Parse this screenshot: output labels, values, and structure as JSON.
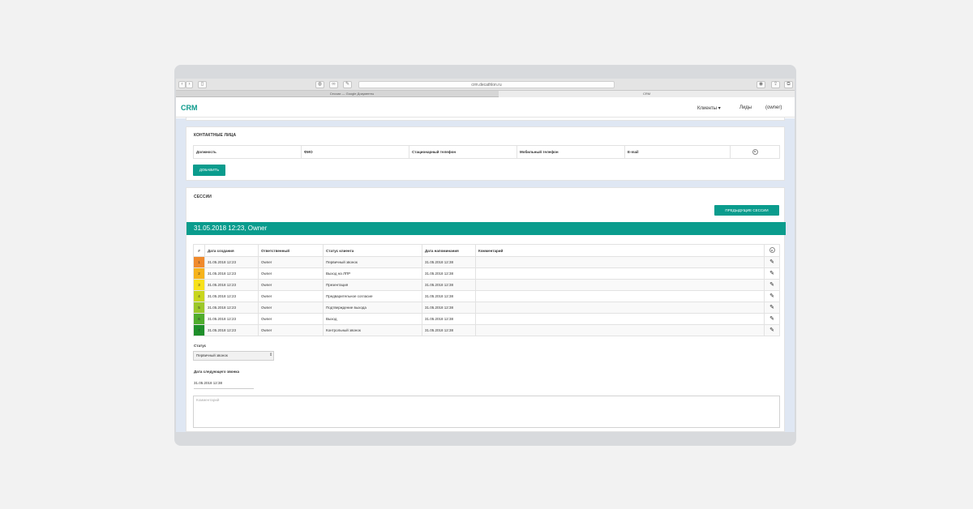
{
  "browser": {
    "url": "crm.decathlon.ru",
    "tabs": [
      "Сессии — Google Документы",
      "CRM"
    ]
  },
  "header": {
    "logo": "CRM",
    "nav": [
      "Клиенты ▾",
      "Лиды",
      "(owner)"
    ]
  },
  "contacts": {
    "title": "КОНТАКТНЫЕ ЛИЦА",
    "columns": [
      "Должность",
      "ФИО",
      "Стационарный телефон",
      "Мобильный телефон",
      "E-mail"
    ],
    "add_label": "ДОБАВИТЬ"
  },
  "sessions": {
    "title": "СЕССИИ",
    "prev_label": "ПРЕДЫДУЩИЕ СЕССИИ",
    "current": "31.05.2018 12:23, Owner",
    "columns": [
      "#",
      "Дата создания",
      "Ответственный",
      "Статус клиента",
      "Дата напоминания",
      "Комментарий"
    ],
    "rows": [
      {
        "n": "1",
        "created": "31.05.2018 12:23",
        "owner": "Owner",
        "status": "Первичный звонок",
        "remind": "31.05.2018 12:38",
        "comment": "",
        "color": "#f08a2c"
      },
      {
        "n": "2",
        "created": "31.05.2018 12:23",
        "owner": "Owner",
        "status": "Выход на ЛПР",
        "remind": "31.05.2018 12:38",
        "comment": "",
        "color": "#f6b31b"
      },
      {
        "n": "3",
        "created": "31.05.2018 12:23",
        "owner": "Owner",
        "status": "Презентация",
        "remind": "31.05.2018 12:38",
        "comment": "",
        "color": "#f7e11b"
      },
      {
        "n": "4",
        "created": "31.05.2018 12:23",
        "owner": "Owner",
        "status": "Предварительное согласие",
        "remind": "31.05.2018 12:38",
        "comment": "",
        "color": "#c8d61c"
      },
      {
        "n": "5",
        "created": "31.05.2018 12:23",
        "owner": "Owner",
        "status": "Подтверждение выхода",
        "remind": "31.05.2018 12:38",
        "comment": "",
        "color": "#9cc82a"
      },
      {
        "n": "6",
        "created": "31.05.2018 12:23",
        "owner": "Owner",
        "status": "Выход",
        "remind": "31.05.2018 12:38",
        "comment": "",
        "color": "#4fad2d"
      },
      {
        "n": "7",
        "created": "31.05.2018 12:23",
        "owner": "Owner",
        "status": "Контрольный звонок",
        "remind": "31.05.2018 12:38",
        "comment": "",
        "color": "#1e8f2a"
      }
    ],
    "status_label": "Статус",
    "status_value": "Первичный звонок",
    "next_call_label": "Дата следующего звонка",
    "next_call_value": "31.05.2018 12:38",
    "comment_placeholder": "Комментарий"
  }
}
